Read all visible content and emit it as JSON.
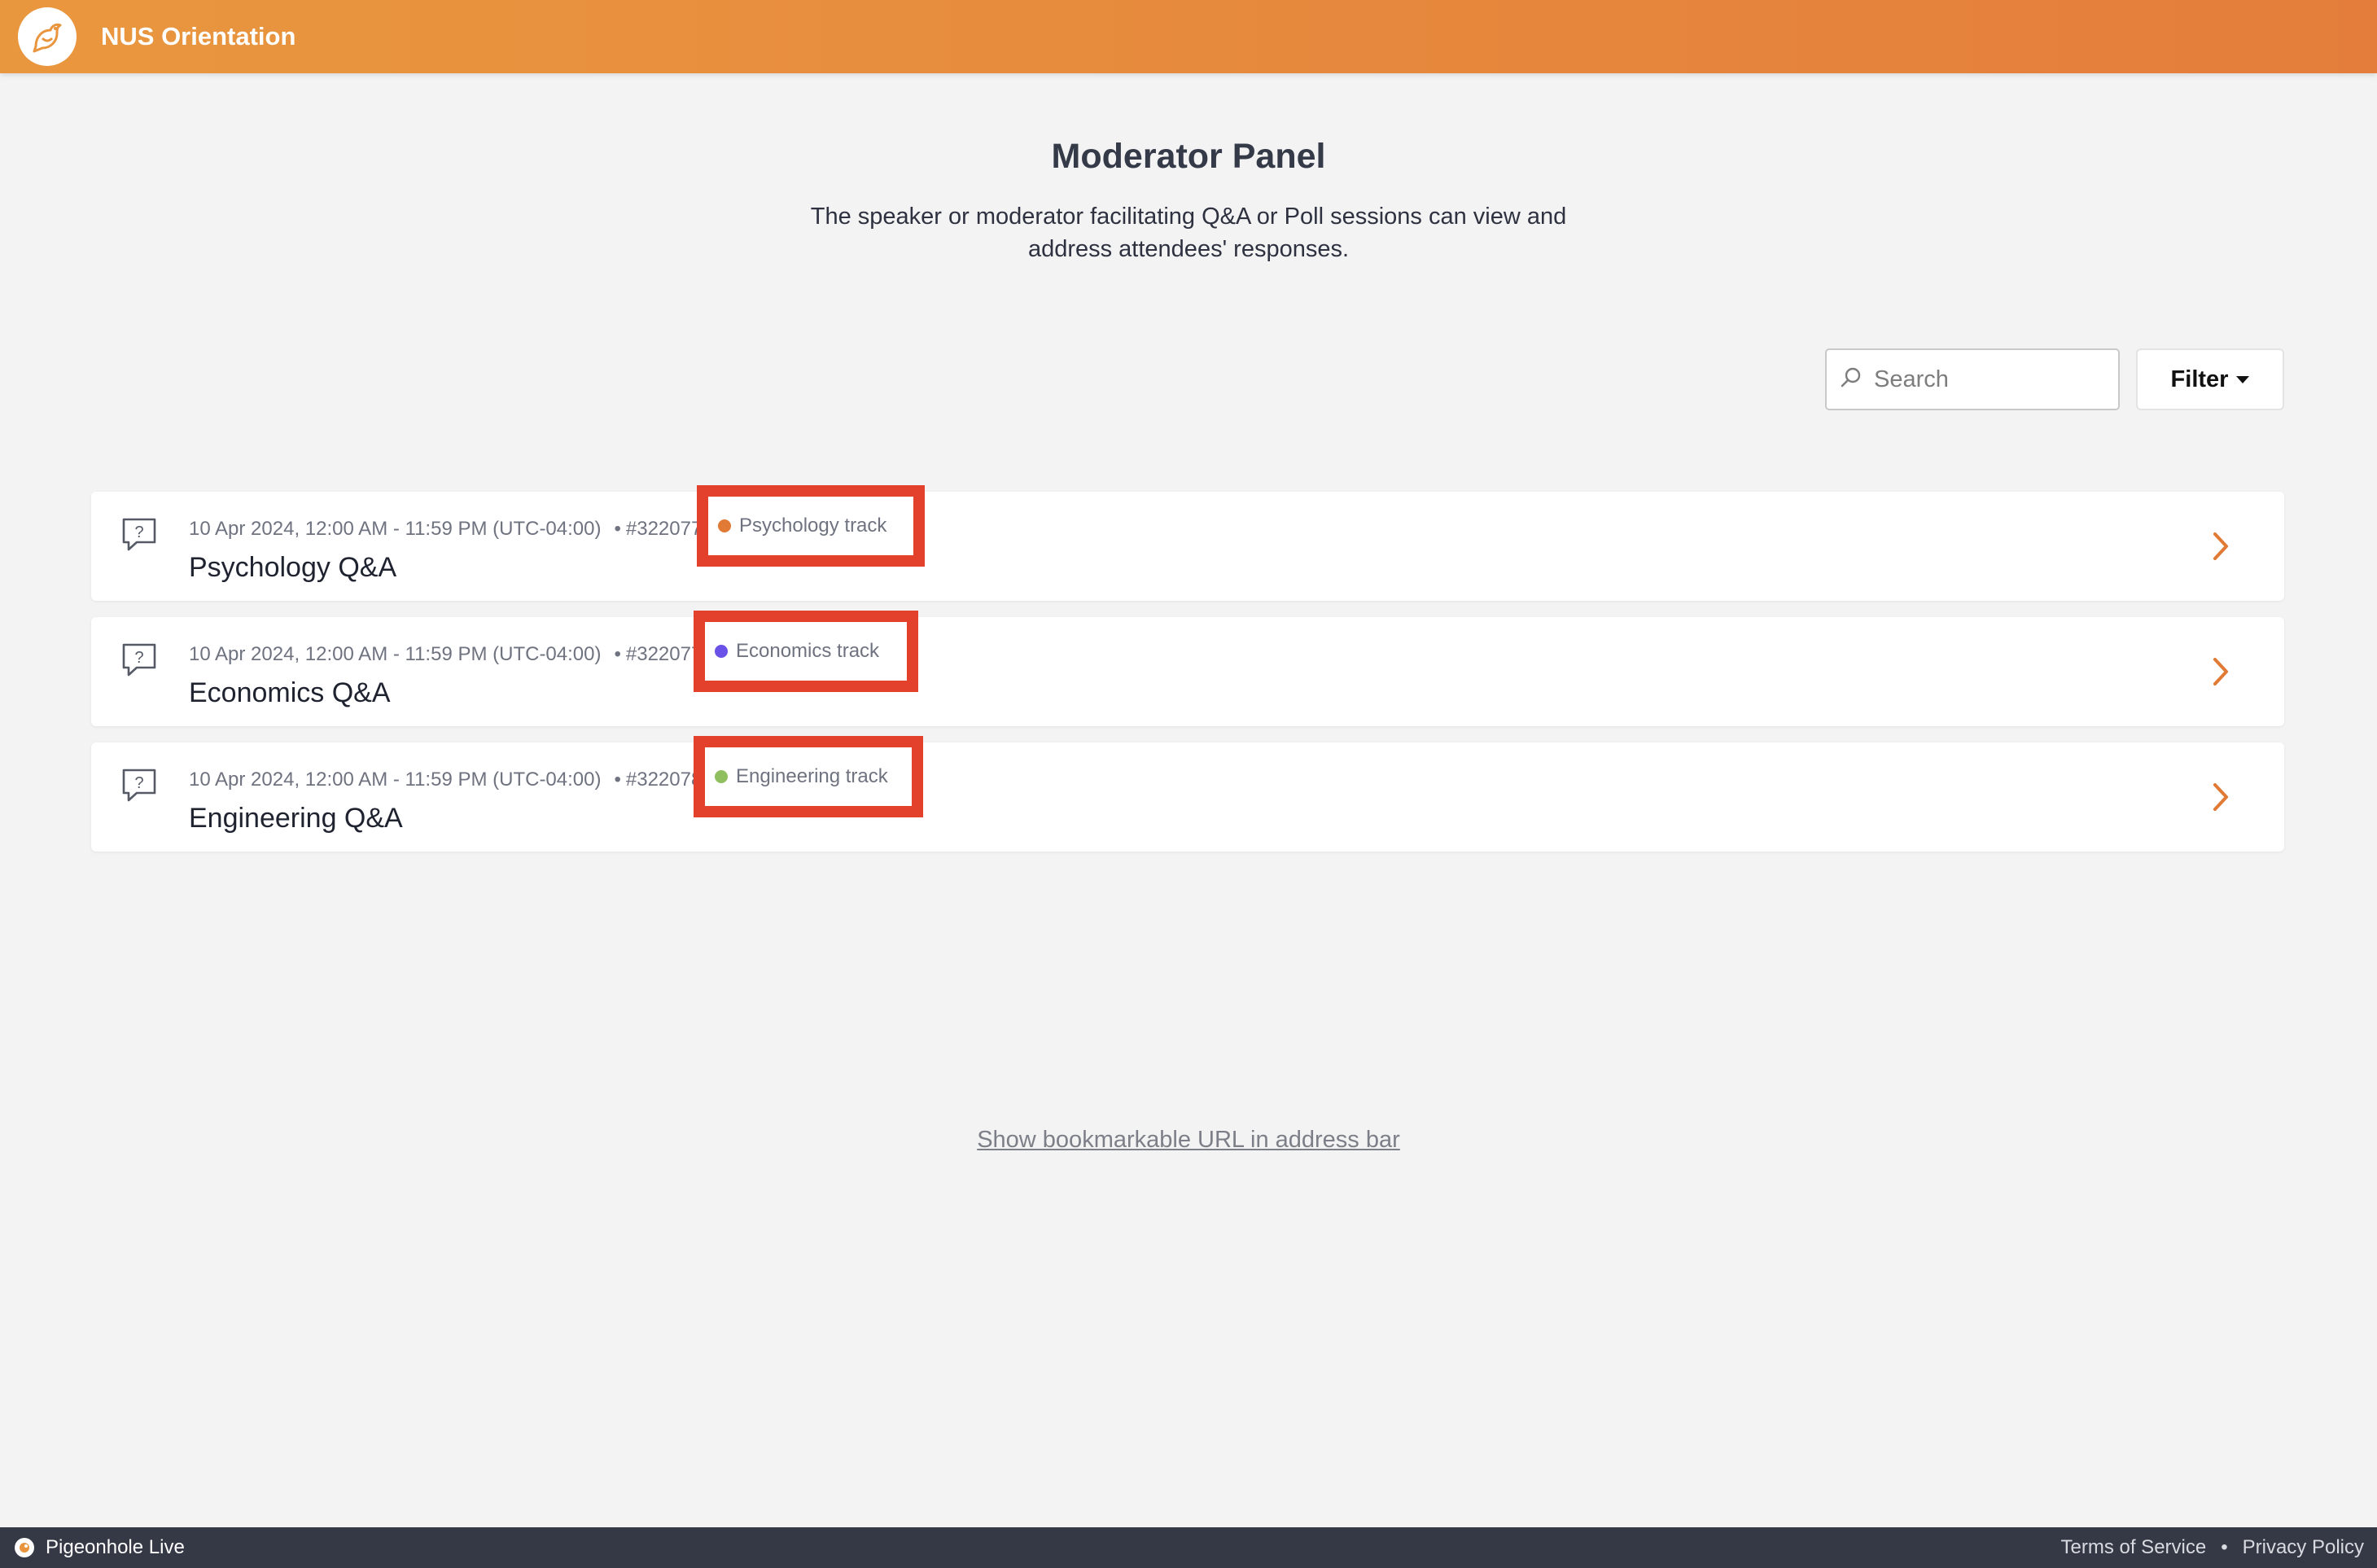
{
  "header": {
    "app_title": "NUS Orientation",
    "logo_icon": "pigeon-logo-icon"
  },
  "page": {
    "title": "Moderator Panel",
    "description_line1": "The speaker or moderator facilitating Q&A or Poll sessions can view and",
    "description_line2": "address attendees' responses."
  },
  "toolbar": {
    "search_placeholder": "Search",
    "filter_label": "Filter"
  },
  "sessions": [
    {
      "datetime": "10 Apr 2024, 12:00 AM - 11:59 PM (UTC-04:00)",
      "separator": "•",
      "id": "#3220776",
      "track": "Psychology track",
      "track_color": "#e07a35",
      "name": "Psychology Q&A",
      "icon": "question-bubble-icon"
    },
    {
      "datetime": "10 Apr 2024, 12:00 AM - 11:59 PM (UTC-04:00)",
      "separator": "•",
      "id": "#3220779",
      "track": "Economics track",
      "track_color": "#6a52e8",
      "name": "Economics Q&A",
      "icon": "question-bubble-icon"
    },
    {
      "datetime": "10 Apr 2024, 12:00 AM - 11:59 PM (UTC-04:00)",
      "separator": "•",
      "id": "#3220789",
      "track": "Engineering track",
      "track_color": "#8fbf5f",
      "name": "Engineering Q&A",
      "icon": "question-bubble-icon"
    }
  ],
  "bookmark_link": "Show bookmarkable URL in address bar",
  "footer": {
    "brand": "Pigeonhole Live",
    "terms": "Terms of Service",
    "bullet": "•",
    "privacy": "Privacy Policy"
  },
  "colors": {
    "header_start": "#e9973f",
    "header_end": "#e47d3b",
    "accent_chevron": "#e07a35",
    "highlight_box": "#e3412c",
    "footer_bg": "#353946"
  }
}
